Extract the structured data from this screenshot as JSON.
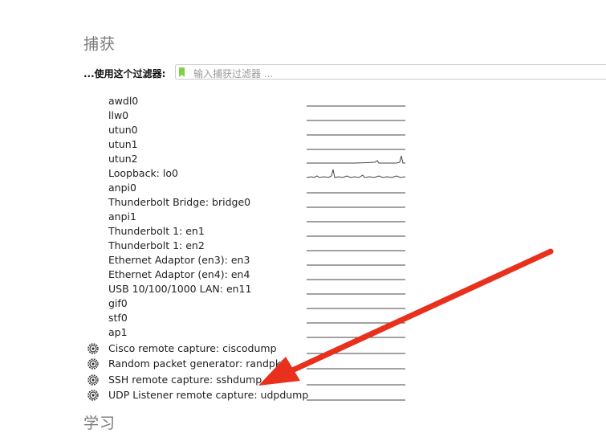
{
  "capture": {
    "title": "捕获",
    "filter_label": "...使用这个过滤器:",
    "filter_placeholder": "输入捕获过滤器 ...",
    "interfaces": [
      {
        "name": "awdl0",
        "type": "local",
        "activity": "flat"
      },
      {
        "name": "llw0",
        "type": "local",
        "activity": "flat"
      },
      {
        "name": "utun0",
        "type": "local",
        "activity": "flat"
      },
      {
        "name": "utun1",
        "type": "local",
        "activity": "flat"
      },
      {
        "name": "utun2",
        "type": "local",
        "activity": "spike-end"
      },
      {
        "name": "Loopback: lo0",
        "type": "local",
        "activity": "busy"
      },
      {
        "name": "anpi0",
        "type": "local",
        "activity": "flat"
      },
      {
        "name": "Thunderbolt Bridge: bridge0",
        "type": "local",
        "activity": "flat"
      },
      {
        "name": "anpi1",
        "type": "local",
        "activity": "flat"
      },
      {
        "name": "Thunderbolt 1: en1",
        "type": "local",
        "activity": "flat"
      },
      {
        "name": "Thunderbolt 1: en2",
        "type": "local",
        "activity": "flat"
      },
      {
        "name": "Ethernet Adaptor (en3): en3",
        "type": "local",
        "activity": "flat"
      },
      {
        "name": "Ethernet Adaptor (en4): en4",
        "type": "local",
        "activity": "flat"
      },
      {
        "name": "USB 10/100/1000 LAN: en11",
        "type": "local",
        "activity": "flat"
      },
      {
        "name": "gif0",
        "type": "local",
        "activity": "flat"
      },
      {
        "name": "stf0",
        "type": "local",
        "activity": "flat"
      },
      {
        "name": "ap1",
        "type": "local",
        "activity": "flat"
      },
      {
        "name": "Cisco remote capture: ciscodump",
        "type": "extcap",
        "activity": "flat"
      },
      {
        "name": "Random packet generator: randpkt",
        "type": "extcap",
        "activity": "flat"
      },
      {
        "name": "SSH remote capture: sshdump",
        "type": "extcap",
        "activity": "flat"
      },
      {
        "name": "UDP Listener remote capture: udpdump",
        "type": "extcap",
        "activity": "flat"
      }
    ]
  },
  "next_section": {
    "title": "学习"
  },
  "annotation": {
    "arrow_color": "#e8301c",
    "target": "SSH remote capture: sshdump"
  },
  "colors": {
    "bookmark": "#7fd046",
    "sparkline": "#444444"
  }
}
